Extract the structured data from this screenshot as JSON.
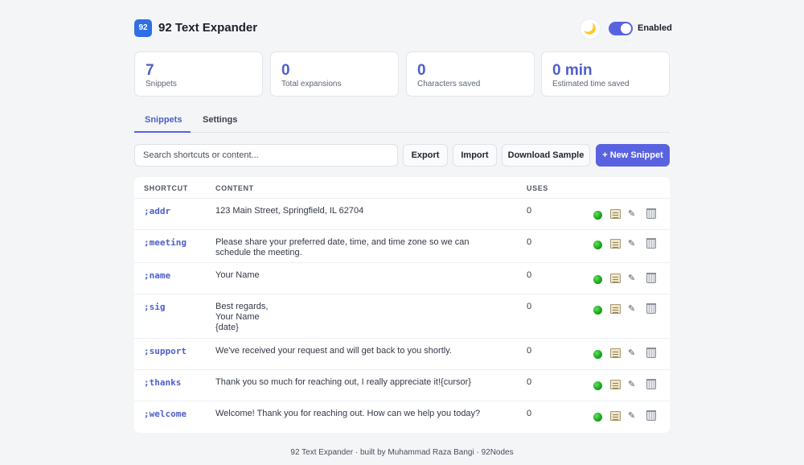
{
  "header": {
    "logo_text": "92",
    "title": "92 Text Expander",
    "theme_icon": "🌙",
    "enabled_label": "Enabled",
    "enabled": true
  },
  "stats": [
    {
      "value": "7",
      "label": "Snippets"
    },
    {
      "value": "0",
      "label": "Total expansions"
    },
    {
      "value": "0",
      "label": "Characters saved"
    },
    {
      "value": "0 min",
      "label": "Estimated time saved"
    }
  ],
  "tabs": [
    {
      "label": "Snippets",
      "active": true
    },
    {
      "label": "Settings",
      "active": false
    }
  ],
  "toolbar": {
    "search_placeholder": "Search shortcuts or content...",
    "export_label": "Export",
    "import_label": "Import",
    "download_sample_label": "Download Sample",
    "new_snippet_label": "+ New Snippet"
  },
  "table": {
    "columns": [
      "SHORTCUT",
      "CONTENT",
      "USES"
    ],
    "rows": [
      {
        "shortcut": ";addr",
        "content": "123 Main Street, Springfield, IL 62704",
        "uses": "0"
      },
      {
        "shortcut": ";meeting",
        "content": "Please share your preferred date, time, and time zone so we can\nschedule the meeting.",
        "uses": "0"
      },
      {
        "shortcut": ";name",
        "content": "Your Name",
        "uses": "0"
      },
      {
        "shortcut": ";sig",
        "content": "Best regards,\nYour Name\n{date}",
        "uses": "0"
      },
      {
        "shortcut": ";support",
        "content": "We've received your request and will get back to you shortly.",
        "uses": "0"
      },
      {
        "shortcut": ";thanks",
        "content": "Thank you so much for reaching out, I really appreciate it!{cursor}",
        "uses": "0"
      },
      {
        "shortcut": ";welcome",
        "content": "Welcome! Thank you for reaching out. How can we help you today?",
        "uses": "0"
      }
    ],
    "row_icons": {
      "status": "green-circle-icon",
      "copy": "clipboard-icon",
      "edit": "pencil-icon",
      "delete": "trash-icon",
      "edit_glyph": "✎"
    }
  },
  "footer": {
    "text": "92 Text Expander · built by Muhammad Raza Bangi · 92Nodes"
  },
  "colors": {
    "accent": "#5a63df",
    "stat_value": "#4d60c9",
    "logo": "#2f6fe4",
    "background": "#f4f5f7"
  }
}
